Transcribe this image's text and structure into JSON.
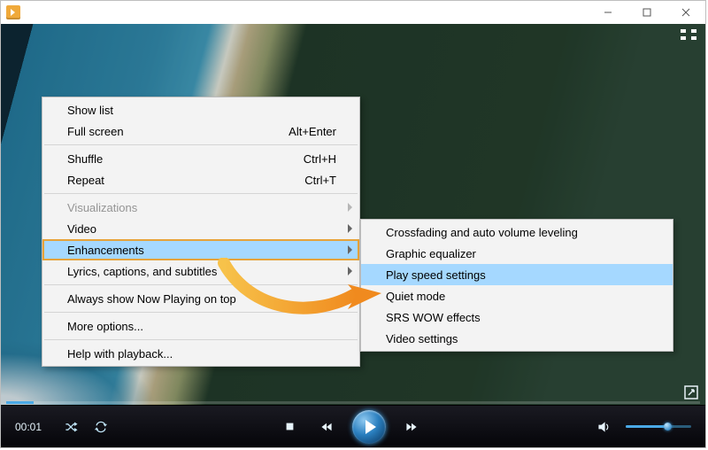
{
  "window": {
    "title": ""
  },
  "win_buttons": {
    "min": "minimize",
    "max": "maximize",
    "close": "close"
  },
  "playback": {
    "time": "00:01",
    "progress_percent": 4,
    "volume_percent": 60
  },
  "controls": {
    "shuffle": "Shuffle",
    "repeat": "Repeat",
    "stop": "Stop",
    "prev": "Previous",
    "play": "Play",
    "next": "Next",
    "mute": "Mute"
  },
  "context_menu": {
    "items": [
      {
        "label": "Show list",
        "shortcut": "",
        "type": "item"
      },
      {
        "label": "Full screen",
        "shortcut": "Alt+Enter",
        "type": "item"
      },
      {
        "type": "sep"
      },
      {
        "label": "Shuffle",
        "shortcut": "Ctrl+H",
        "type": "item"
      },
      {
        "label": "Repeat",
        "shortcut": "Ctrl+T",
        "type": "item"
      },
      {
        "type": "sep"
      },
      {
        "label": "Visualizations",
        "type": "submenu",
        "disabled": true
      },
      {
        "label": "Video",
        "type": "submenu"
      },
      {
        "label": "Enhancements",
        "type": "submenu",
        "highlight": true
      },
      {
        "label": "Lyrics, captions, and subtitles",
        "type": "submenu"
      },
      {
        "type": "sep"
      },
      {
        "label": "Always show Now Playing on top",
        "type": "item"
      },
      {
        "type": "sep"
      },
      {
        "label": "More options...",
        "type": "item"
      },
      {
        "type": "sep"
      },
      {
        "label": "Help with playback...",
        "type": "item"
      }
    ]
  },
  "enhancements_submenu": {
    "items": [
      {
        "label": "Crossfading and auto volume leveling"
      },
      {
        "label": "Graphic equalizer"
      },
      {
        "label": "Play speed settings",
        "highlight": true
      },
      {
        "label": "Quiet mode"
      },
      {
        "label": "SRS WOW effects"
      },
      {
        "label": "Video settings"
      }
    ]
  }
}
